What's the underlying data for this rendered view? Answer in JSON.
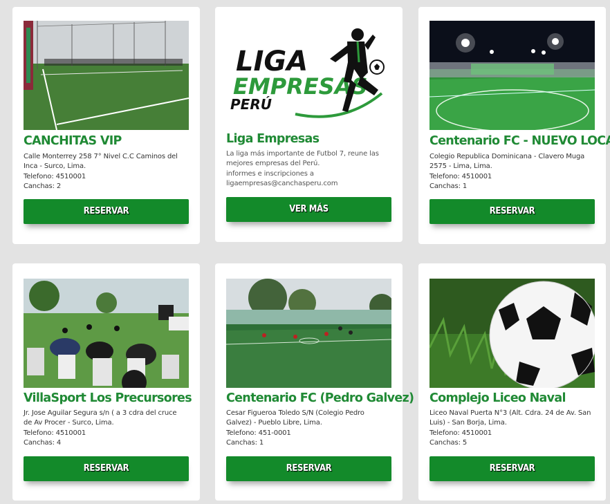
{
  "cards": [
    {
      "name": "CANCHITAS VIP",
      "lines": [
        "Calle Monterrey 258 7° Nivel C.C Caminos del",
        "Inca - Surco, Lima.",
        "Telefono: 4510001",
        "Canchas: 2"
      ],
      "button": "RESERVAR"
    },
    {
      "name": "Liga Empresas",
      "logo": {
        "line1": "LIGA",
        "line2": "EMPRESAS",
        "line3": "PERÚ"
      },
      "lines": [
        "La liga más importante de Futbol 7, reune las",
        "mejores empresas del Perú.",
        "informes e inscripciones a",
        "ligaempresas@canchasperu.com"
      ],
      "button": "VER MÁS"
    },
    {
      "name": "Centenario FC - NUEVO LOCAL",
      "lines": [
        "Colegio Republica Dominicana - Clavero Muga",
        "2575 - Lima, Lima.",
        "Telefono: 4510001",
        "Canchas: 1"
      ],
      "button": "RESERVAR"
    },
    {
      "name": "VillaSport Los Precursores",
      "lines": [
        "Jr. Jose Aguilar Segura s/n ( a 3 cdra del cruce",
        "de Av Procer - Surco, Lima.",
        "Telefono: 4510001",
        "Canchas: 4"
      ],
      "button": "RESERVAR"
    },
    {
      "name": "Centenario FC (Pedro Galvez)",
      "lines": [
        "Cesar Figueroa Toledo S/N (Colegio Pedro",
        "Galvez) - Pueblo Libre, Lima.",
        "Telefono: 451-0001",
        "Canchas: 1"
      ],
      "button": "RESERVAR"
    },
    {
      "name": "Complejo Liceo Naval",
      "lines": [
        "Liceo Naval Puerta N°3 (Alt. Cdra. 24 de Av. San",
        "Luis) - San Borja, Lima.",
        "Telefono: 4510001",
        "Canchas: 5"
      ],
      "button": "RESERVAR"
    }
  ]
}
